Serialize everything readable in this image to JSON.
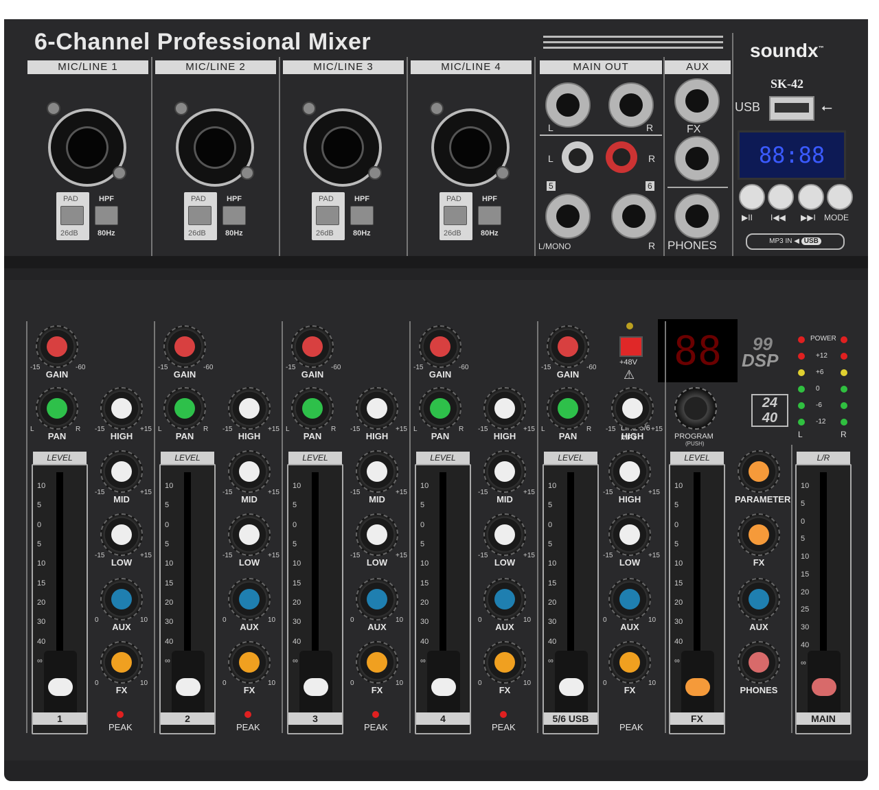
{
  "title": "6-Channel Professional Mixer",
  "brand": "soundx",
  "trademark": "™",
  "model": "SK-42",
  "usb_label": "USB",
  "inputs": [
    {
      "label": "MIC/LINE 1",
      "pad": "PAD",
      "pad_value": "26dB",
      "hpf": "HPF",
      "hpf_value": "80Hz"
    },
    {
      "label": "MIC/LINE 2",
      "pad": "PAD",
      "pad_value": "26dB",
      "hpf": "HPF",
      "hpf_value": "80Hz"
    },
    {
      "label": "MIC/LINE 3",
      "pad": "PAD",
      "pad_value": "26dB",
      "hpf": "HPF",
      "hpf_value": "80Hz"
    },
    {
      "label": "MIC/LINE 4",
      "pad": "PAD",
      "pad_value": "26dB",
      "hpf": "HPF",
      "hpf_value": "80Hz"
    }
  ],
  "main_out": {
    "label": "MAIN OUT",
    "l": "L",
    "r": "R",
    "ch5": "5",
    "ch6": "6",
    "lmono": "L/MONO"
  },
  "aux": {
    "label": "AUX",
    "fx": "FX",
    "phones": "PHONES"
  },
  "player": {
    "lcd": "88:88",
    "buttons": [
      "▶II",
      "I◀◀",
      "▶▶I",
      "MODE"
    ],
    "mp3in": "MP3 IN",
    "usb": "USB"
  },
  "channel_knobs": {
    "gain": "GAIN",
    "pan": "PAN",
    "high": "HIGH",
    "mid": "MID",
    "low": "LOW",
    "aux": "AUX",
    "fx": "FX",
    "gain_min": "-15",
    "gain_max": "-60",
    "pan_l": "L",
    "pan_r": "R",
    "eq_min": "-15",
    "eq_max": "+15",
    "send_min": "0",
    "send_max": "10"
  },
  "fader": {
    "level": "LEVEL",
    "scale": [
      "10",
      "5",
      "0",
      "5",
      "10",
      "15",
      "20",
      "30",
      "40",
      "∞"
    ]
  },
  "channels": [
    "1",
    "2",
    "3",
    "4",
    "5/6 USB"
  ],
  "peak": "PEAK",
  "phantom": "+48V",
  "dsp": {
    "display": "88",
    "count": "99",
    "label": "DSP",
    "bits": "24",
    "khz": "40"
  },
  "source_switch": {
    "line": "LINE 5/6",
    "mp3": "MP3"
  },
  "program": {
    "label": "PROGRAM",
    "sub": "(PUSH)"
  },
  "fx_master": {
    "level": "LEVEL",
    "parameter": "PARAMETER",
    "fx": "FX",
    "aux": "AUX",
    "phones": "PHONES",
    "num": "FX"
  },
  "main_fader": {
    "label": "L/R",
    "num": "MAIN",
    "scale": [
      "10",
      "5",
      "0",
      "5",
      "10",
      "15",
      "20",
      "25",
      "30",
      "40",
      "∞"
    ]
  },
  "meter": {
    "power": "POWER",
    "levels": [
      "+12",
      "+6",
      "0",
      "-6",
      "-12"
    ],
    "l": "L",
    "r": "R"
  },
  "colors": {
    "panel": "#29292b",
    "gain": "#d84040",
    "pan": "#2ec04a",
    "eq": "#eeeeee",
    "aux": "#1f7fb0",
    "fx": "#f0a020",
    "param": "#f59a3a",
    "led_red": "#e02020",
    "led_yellow": "#e0d030",
    "led_green": "#30c040"
  }
}
